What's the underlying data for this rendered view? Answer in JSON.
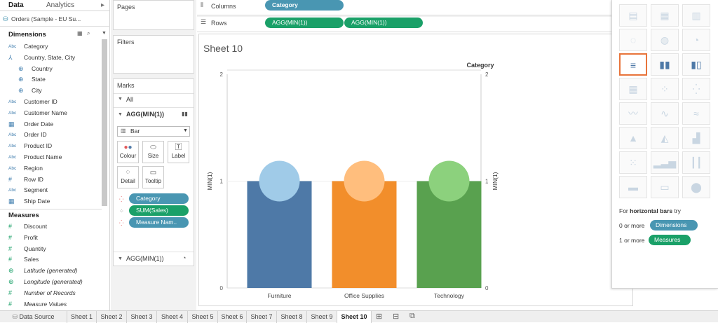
{
  "data_panel": {
    "tabs": [
      "Data",
      "Analytics"
    ],
    "datasource": "Orders (Sample - EU Su...",
    "dimensions_header": "Dimensions",
    "dimensions": [
      {
        "label": "Category",
        "type": "Abc"
      },
      {
        "label": "Country, State, City",
        "type": "hier"
      },
      {
        "label": "Country",
        "type": "geo",
        "indent": true
      },
      {
        "label": "State",
        "type": "geo",
        "indent": true
      },
      {
        "label": "City",
        "type": "geo",
        "indent": true
      },
      {
        "label": "Customer ID",
        "type": "Abc"
      },
      {
        "label": "Customer Name",
        "type": "Abc"
      },
      {
        "label": "Order Date",
        "type": "date"
      },
      {
        "label": "Order ID",
        "type": "Abc"
      },
      {
        "label": "Product ID",
        "type": "Abc"
      },
      {
        "label": "Product Name",
        "type": "Abc"
      },
      {
        "label": "Region",
        "type": "Abc"
      },
      {
        "label": "Row ID",
        "type": "#"
      },
      {
        "label": "Segment",
        "type": "Abc"
      },
      {
        "label": "Ship Date",
        "type": "date"
      }
    ],
    "measures_header": "Measures",
    "measures": [
      {
        "label": "Discount",
        "type": "#"
      },
      {
        "label": "Profit",
        "type": "#"
      },
      {
        "label": "Quantity",
        "type": "#"
      },
      {
        "label": "Sales",
        "type": "#"
      },
      {
        "label": "Latitude (generated)",
        "type": "geo",
        "italic": true
      },
      {
        "label": "Longitude (generated)",
        "type": "geo",
        "italic": true
      },
      {
        "label": "Number of Records",
        "type": "#",
        "italic": true
      },
      {
        "label": "Measure Values",
        "type": "#",
        "italic": true
      }
    ]
  },
  "shelves": {
    "pages": "Pages",
    "filters": "Filters",
    "columns_label": "Columns",
    "rows_label": "Rows",
    "columns_pill": "Category",
    "rows_pills": [
      "AGG(MIN(1))",
      "AGG(MIN(1))"
    ]
  },
  "marks": {
    "title": "Marks",
    "all": "All",
    "card1_title": "AGG(MIN(1))",
    "mark_type": "Bar",
    "buttons": [
      "Colour",
      "Size",
      "Label",
      "Detail",
      "Tooltip"
    ],
    "pills": [
      "Category",
      "SUM(Sales)",
      "Measure Nam.."
    ],
    "card2_title": "AGG(MIN(1))"
  },
  "sheet_title": "Sheet 10",
  "chart_data": {
    "type": "bar",
    "title": "Category",
    "categories": [
      "Furniture",
      "Office Supplies",
      "Technology"
    ],
    "values": [
      1,
      1,
      1
    ],
    "colors": [
      "#4e79a7",
      "#f28e2b",
      "#59a14f"
    ],
    "circle_colors": [
      "#a0cbe8",
      "#ffbe7d",
      "#8cd17d"
    ],
    "ylabel_left": "MIN(1)",
    "ylabel_right": "MIN(1)",
    "ylim": [
      0,
      2
    ],
    "yticks": [
      "2",
      "1",
      "0"
    ]
  },
  "showme": {
    "hint_prefix": "For",
    "hint_bold": "horizontal bars",
    "hint_suffix": "try",
    "dims_req": "0 or more",
    "dims_pill": "Dimensions",
    "meas_req": "1 or more",
    "meas_pill": "Measures"
  },
  "bottom_tabs": [
    "Data Source",
    "Sheet 1",
    "Sheet 2",
    "Sheet 3",
    "Sheet 4",
    "Sheet 5",
    "Sheet 6",
    "Sheet 7",
    "Sheet 8",
    "Sheet 9",
    "Sheet 10"
  ],
  "active_tab": "Sheet 10"
}
